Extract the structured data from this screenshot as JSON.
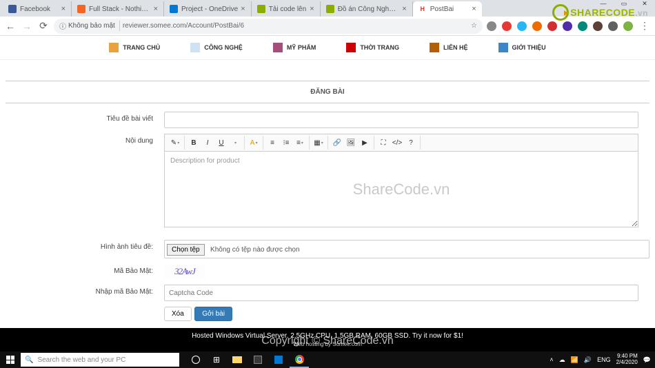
{
  "window": {
    "title": "PostBai"
  },
  "tabs": [
    {
      "title": "Facebook",
      "color": "#3b5998"
    },
    {
      "title": "Full Stack - Nothing is...",
      "color": "#f26522"
    },
    {
      "title": "Project - OneDrive",
      "color": "#0078d4"
    },
    {
      "title": "Tải code lên",
      "color": "#8aad00"
    },
    {
      "title": "Đồ án Công Nghệ Phầ...",
      "color": "#8aad00"
    },
    {
      "title": "PostBai",
      "color": "#d33",
      "active": true
    }
  ],
  "addressBar": {
    "security": "Không bảo mật",
    "url": "reviewer.somee.com/Account/PostBai/6"
  },
  "nav": [
    {
      "label": "TRANG CHỦ",
      "color": "#e8a33d"
    },
    {
      "label": "CÔNG NGHỆ",
      "color": "#6fa8dc"
    },
    {
      "label": "MỸ PHẨM",
      "color": "#a64d79"
    },
    {
      "label": "THỜI TRANG",
      "color": "#cc0000"
    },
    {
      "label": "LIÊN HỆ",
      "color": "#b45f06"
    },
    {
      "label": "GIỚI THIỆU",
      "color": "#3d85c6"
    }
  ],
  "page": {
    "sectionTitle": "ĐĂNG BÀI",
    "labels": {
      "title": "Tiêu đề bài viết",
      "content": "Nội dung",
      "thumbnail": "Hình ảnh tiêu đề:",
      "captcha": "Mã Bảo Mật:",
      "enterCaptcha": "Nhập mã Bảo Mật:"
    },
    "editor": {
      "placeholder": "Description for product"
    },
    "fileInput": {
      "button": "Chọn tệp",
      "status": "Không có tệp nào được chọn"
    },
    "captchaImage": "32AwJ",
    "captchaPlaceholder": "Captcha Code",
    "buttons": {
      "clear": "Xóa",
      "submit": "Gởi bài"
    }
  },
  "footer": {
    "banner": "Hosted Windows Virtual Server. 2.5GHz CPU, 1.5GB RAM, 60GB SSD. Try it now for $1!",
    "sub": "Web hosting by Somee.com"
  },
  "watermark": {
    "center": "ShareCode.vn",
    "footer": "Copyright © ShareCode.vn",
    "logo": "SHARECODE",
    "logoSuffix": ".vn"
  },
  "taskbar": {
    "searchPlaceholder": "Search the web and your PC",
    "lang": "ENG",
    "time": "9:40 PM",
    "date": "2/4/2020"
  }
}
